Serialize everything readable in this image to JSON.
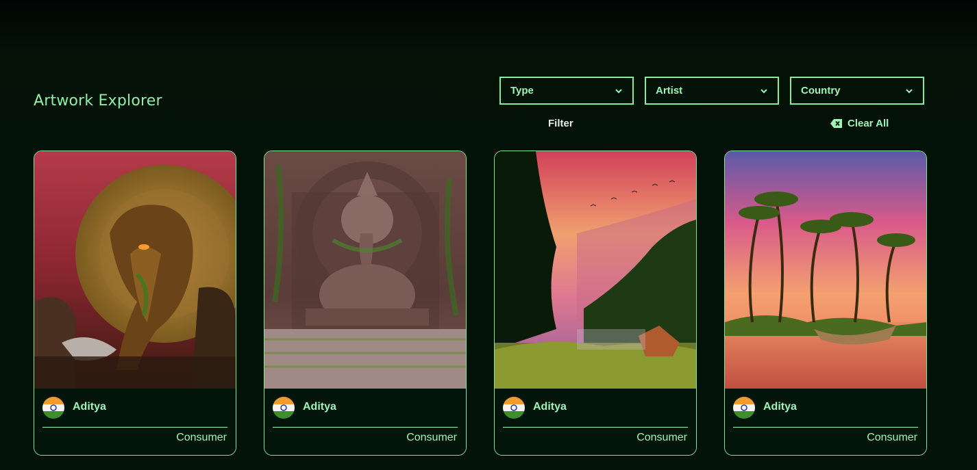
{
  "page": {
    "title": "Artwork Explorer"
  },
  "filters": {
    "type_label": "Type",
    "artist_label": "Artist",
    "country_label": "Country",
    "filter_button": "Filter",
    "clear_all_button": "Clear All"
  },
  "colors": {
    "accent": "#9df5b6",
    "border": "#7ff0a0",
    "background": "#03130a"
  },
  "cards": [
    {
      "artist": "Aditya",
      "type": "Consumer",
      "country_flag": "india-flag-icon",
      "artwork": "ganesha-temple-ruins"
    },
    {
      "artist": "Aditya",
      "type": "Consumer",
      "country_flag": "india-flag-icon",
      "artwork": "ganesha-stone-relief"
    },
    {
      "artist": "Aditya",
      "type": "Consumer",
      "country_flag": "india-flag-icon",
      "artwork": "forest-lake-sunset"
    },
    {
      "artist": "Aditya",
      "type": "Consumer",
      "country_flag": "india-flag-icon",
      "artwork": "palm-island-sunset"
    }
  ]
}
